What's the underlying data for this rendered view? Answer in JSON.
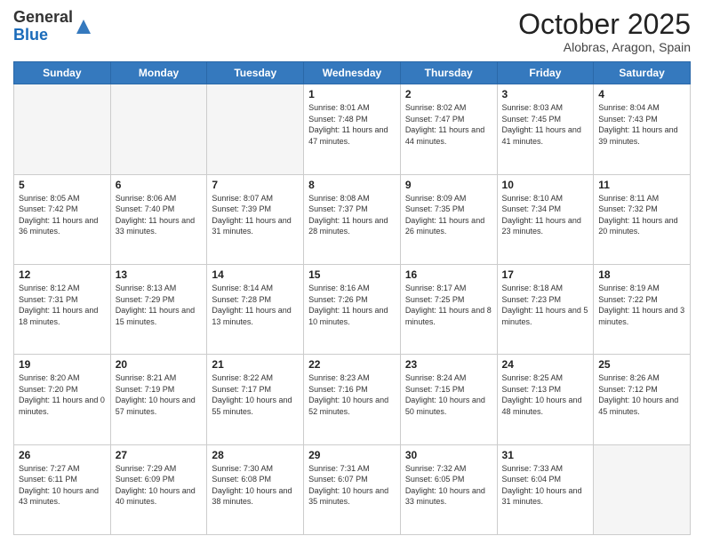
{
  "logo": {
    "general": "General",
    "blue": "Blue"
  },
  "header": {
    "month": "October 2025",
    "location": "Alobras, Aragon, Spain"
  },
  "weekdays": [
    "Sunday",
    "Monday",
    "Tuesday",
    "Wednesday",
    "Thursday",
    "Friday",
    "Saturday"
  ],
  "weeks": [
    [
      {
        "day": "",
        "empty": true
      },
      {
        "day": "",
        "empty": true
      },
      {
        "day": "",
        "empty": true
      },
      {
        "day": "1",
        "sunrise": "8:01 AM",
        "sunset": "7:48 PM",
        "daylight": "11 hours and 47 minutes."
      },
      {
        "day": "2",
        "sunrise": "8:02 AM",
        "sunset": "7:47 PM",
        "daylight": "11 hours and 44 minutes."
      },
      {
        "day": "3",
        "sunrise": "8:03 AM",
        "sunset": "7:45 PM",
        "daylight": "11 hours and 41 minutes."
      },
      {
        "day": "4",
        "sunrise": "8:04 AM",
        "sunset": "7:43 PM",
        "daylight": "11 hours and 39 minutes."
      }
    ],
    [
      {
        "day": "5",
        "sunrise": "8:05 AM",
        "sunset": "7:42 PM",
        "daylight": "11 hours and 36 minutes."
      },
      {
        "day": "6",
        "sunrise": "8:06 AM",
        "sunset": "7:40 PM",
        "daylight": "11 hours and 33 minutes."
      },
      {
        "day": "7",
        "sunrise": "8:07 AM",
        "sunset": "7:39 PM",
        "daylight": "11 hours and 31 minutes."
      },
      {
        "day": "8",
        "sunrise": "8:08 AM",
        "sunset": "7:37 PM",
        "daylight": "11 hours and 28 minutes."
      },
      {
        "day": "9",
        "sunrise": "8:09 AM",
        "sunset": "7:35 PM",
        "daylight": "11 hours and 26 minutes."
      },
      {
        "day": "10",
        "sunrise": "8:10 AM",
        "sunset": "7:34 PM",
        "daylight": "11 hours and 23 minutes."
      },
      {
        "day": "11",
        "sunrise": "8:11 AM",
        "sunset": "7:32 PM",
        "daylight": "11 hours and 20 minutes."
      }
    ],
    [
      {
        "day": "12",
        "sunrise": "8:12 AM",
        "sunset": "7:31 PM",
        "daylight": "11 hours and 18 minutes."
      },
      {
        "day": "13",
        "sunrise": "8:13 AM",
        "sunset": "7:29 PM",
        "daylight": "11 hours and 15 minutes."
      },
      {
        "day": "14",
        "sunrise": "8:14 AM",
        "sunset": "7:28 PM",
        "daylight": "11 hours and 13 minutes."
      },
      {
        "day": "15",
        "sunrise": "8:16 AM",
        "sunset": "7:26 PM",
        "daylight": "11 hours and 10 minutes."
      },
      {
        "day": "16",
        "sunrise": "8:17 AM",
        "sunset": "7:25 PM",
        "daylight": "11 hours and 8 minutes."
      },
      {
        "day": "17",
        "sunrise": "8:18 AM",
        "sunset": "7:23 PM",
        "daylight": "11 hours and 5 minutes."
      },
      {
        "day": "18",
        "sunrise": "8:19 AM",
        "sunset": "7:22 PM",
        "daylight": "11 hours and 3 minutes."
      }
    ],
    [
      {
        "day": "19",
        "sunrise": "8:20 AM",
        "sunset": "7:20 PM",
        "daylight": "11 hours and 0 minutes."
      },
      {
        "day": "20",
        "sunrise": "8:21 AM",
        "sunset": "7:19 PM",
        "daylight": "10 hours and 57 minutes."
      },
      {
        "day": "21",
        "sunrise": "8:22 AM",
        "sunset": "7:17 PM",
        "daylight": "10 hours and 55 minutes."
      },
      {
        "day": "22",
        "sunrise": "8:23 AM",
        "sunset": "7:16 PM",
        "daylight": "10 hours and 52 minutes."
      },
      {
        "day": "23",
        "sunrise": "8:24 AM",
        "sunset": "7:15 PM",
        "daylight": "10 hours and 50 minutes."
      },
      {
        "day": "24",
        "sunrise": "8:25 AM",
        "sunset": "7:13 PM",
        "daylight": "10 hours and 48 minutes."
      },
      {
        "day": "25",
        "sunrise": "8:26 AM",
        "sunset": "7:12 PM",
        "daylight": "10 hours and 45 minutes."
      }
    ],
    [
      {
        "day": "26",
        "sunrise": "7:27 AM",
        "sunset": "6:11 PM",
        "daylight": "10 hours and 43 minutes."
      },
      {
        "day": "27",
        "sunrise": "7:29 AM",
        "sunset": "6:09 PM",
        "daylight": "10 hours and 40 minutes."
      },
      {
        "day": "28",
        "sunrise": "7:30 AM",
        "sunset": "6:08 PM",
        "daylight": "10 hours and 38 minutes."
      },
      {
        "day": "29",
        "sunrise": "7:31 AM",
        "sunset": "6:07 PM",
        "daylight": "10 hours and 35 minutes."
      },
      {
        "day": "30",
        "sunrise": "7:32 AM",
        "sunset": "6:05 PM",
        "daylight": "10 hours and 33 minutes."
      },
      {
        "day": "31",
        "sunrise": "7:33 AM",
        "sunset": "6:04 PM",
        "daylight": "10 hours and 31 minutes."
      },
      {
        "day": "",
        "empty": true
      }
    ]
  ]
}
